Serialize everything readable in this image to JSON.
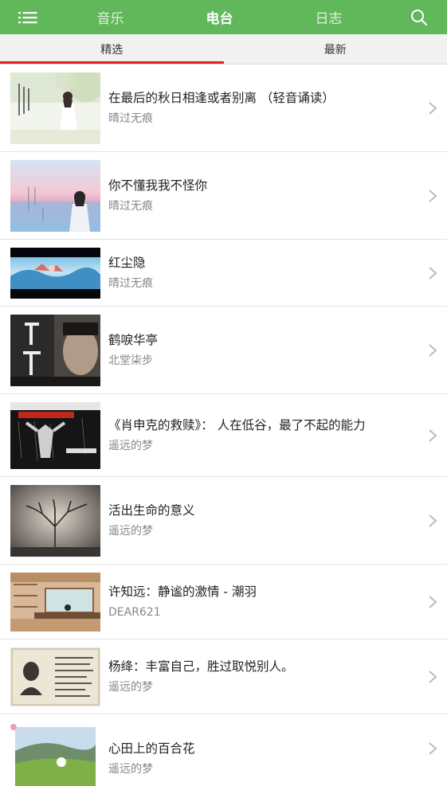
{
  "header": {
    "nav": [
      {
        "label": "音乐",
        "active": false
      },
      {
        "label": "电台",
        "active": true
      },
      {
        "label": "日志",
        "active": false
      }
    ],
    "menu_icon": "list-menu-icon",
    "search_icon": "search-icon",
    "accent_color": "#61b85a"
  },
  "tabs": [
    {
      "label": "精选",
      "active": true
    },
    {
      "label": "最新",
      "active": false
    }
  ],
  "tab_indicator_color": "#e02020",
  "items": [
    {
      "title": "在最后的秋日相逢或者别离 （轻音诵读）",
      "author": "晴过无痕",
      "thumb": "woman-in-white-autumn"
    },
    {
      "title": "你不懂我我不怪你",
      "author": "晴过无痕",
      "thumb": "woman-pink-sky"
    },
    {
      "title": "红尘隐",
      "author": "晴过无痕",
      "thumb": "misty-landscape-banner"
    },
    {
      "title": "鹤唳华亭",
      "author": "北堂柒步",
      "thumb": "drama-poster"
    },
    {
      "title": "《肖申克的救赎》： 人在低谷，最了不起的能力",
      "author": "遥远的梦",
      "thumb": "shawshank-poster"
    },
    {
      "title": "活出生命的意义",
      "author": "遥远的梦",
      "thumb": "bare-tree"
    },
    {
      "title": "许知远：静谧的激情 - 潮羽",
      "author": "DEAR621",
      "thumb": "reading-room"
    },
    {
      "title": "杨绛：丰富自己，胜过取悦别人。",
      "author": "遥远的梦",
      "thumb": "vintage-portrait-letter"
    },
    {
      "title": "心田上的百合花",
      "author": "遥远的梦",
      "thumb": "lily-field"
    }
  ]
}
